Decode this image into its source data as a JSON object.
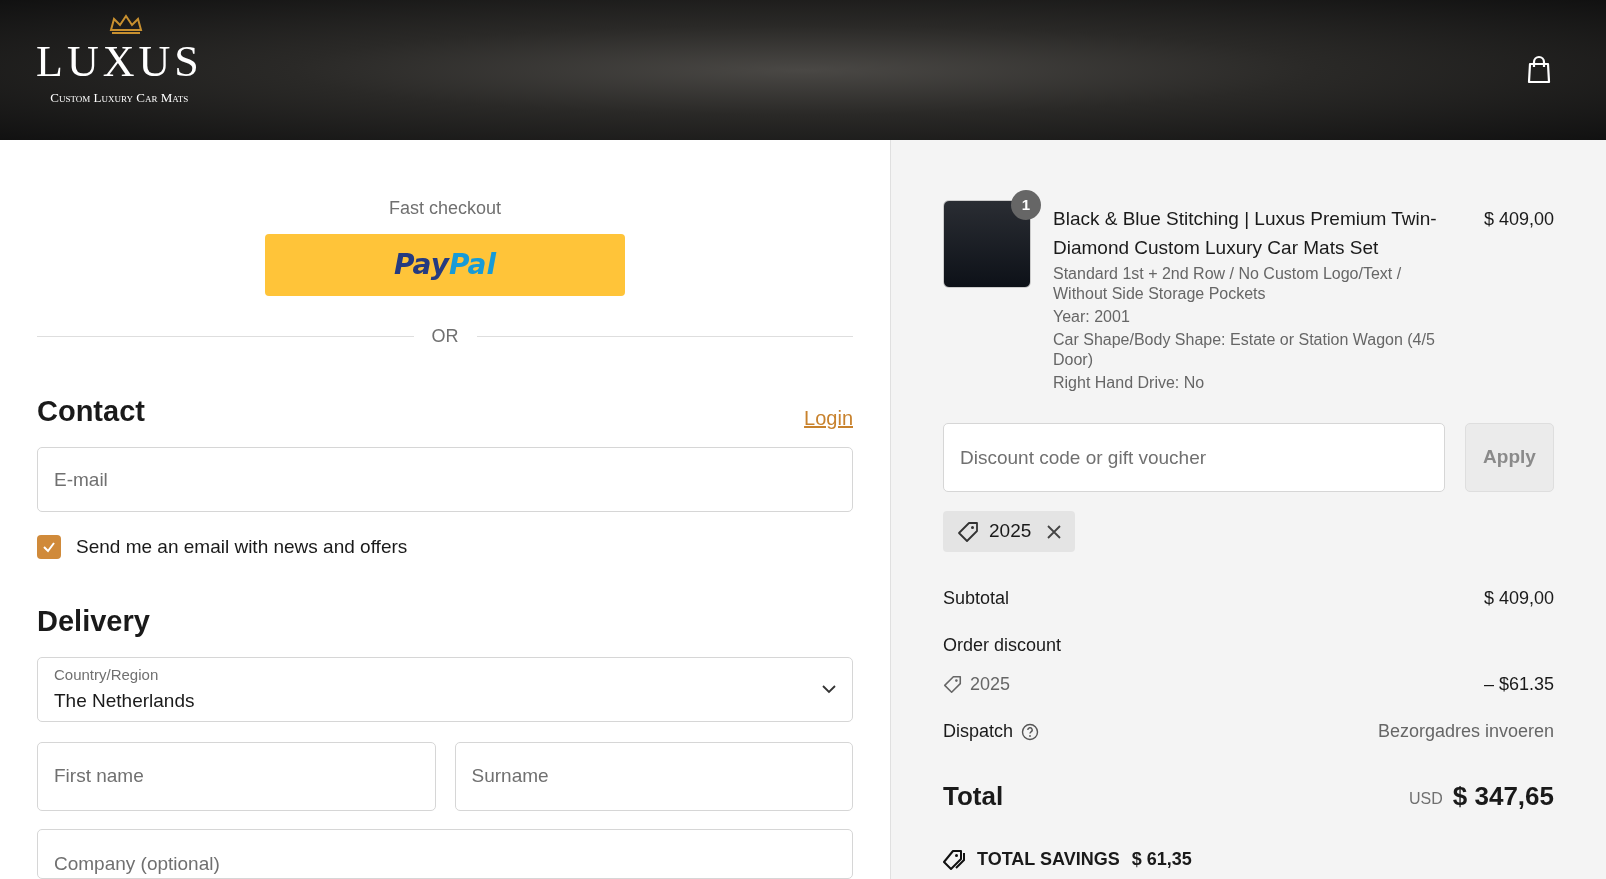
{
  "header": {
    "wordmark": "LUXUS",
    "tagline": "Custom Luxury Car Mats"
  },
  "checkout": {
    "fast_checkout": "Fast checkout",
    "paypal": "PayPal",
    "divider": "OR",
    "contact": {
      "heading": "Contact",
      "login": "Login",
      "email_placeholder": "E-mail",
      "newsletter": {
        "label": "Send me an email with news and offers",
        "checked": true
      }
    },
    "delivery": {
      "heading": "Delivery",
      "country_label": "Country/Region",
      "country_value": "The Netherlands",
      "first_name_placeholder": "First name",
      "surname_placeholder": "Surname",
      "company_placeholder": "Company (optional)"
    }
  },
  "order": {
    "item": {
      "quantity": "1",
      "title": "Black & Blue Stitching | Luxus Premium Twin-Diamond Custom Luxury Car Mats Set",
      "price": "$ 409,00",
      "details": [
        "Standard 1st + 2nd Row / No Custom Logo/Text / Without Side Storage Pockets",
        "Year: 2001",
        "Car Shape/Body Shape: Estate or Station Wagon (4/5 Door)",
        "Right Hand Drive: No"
      ]
    },
    "discount": {
      "placeholder": "Discount code or gift voucher",
      "apply": "Apply",
      "apply_disabled": true,
      "applied_code": "2025"
    },
    "summary": {
      "subtotal_label": "Subtotal",
      "subtotal": "$ 409,00",
      "discount_label": "Order discount",
      "discount_code": "2025",
      "discount_amount": "– $61.35",
      "dispatch_label": "Dispatch",
      "dispatch_value": "Bezorgadres invoeren",
      "total_label": "Total",
      "currency": "USD",
      "total": "$ 347,65",
      "savings_label": "TOTAL SAVINGS",
      "savings": "$ 61,35"
    }
  }
}
